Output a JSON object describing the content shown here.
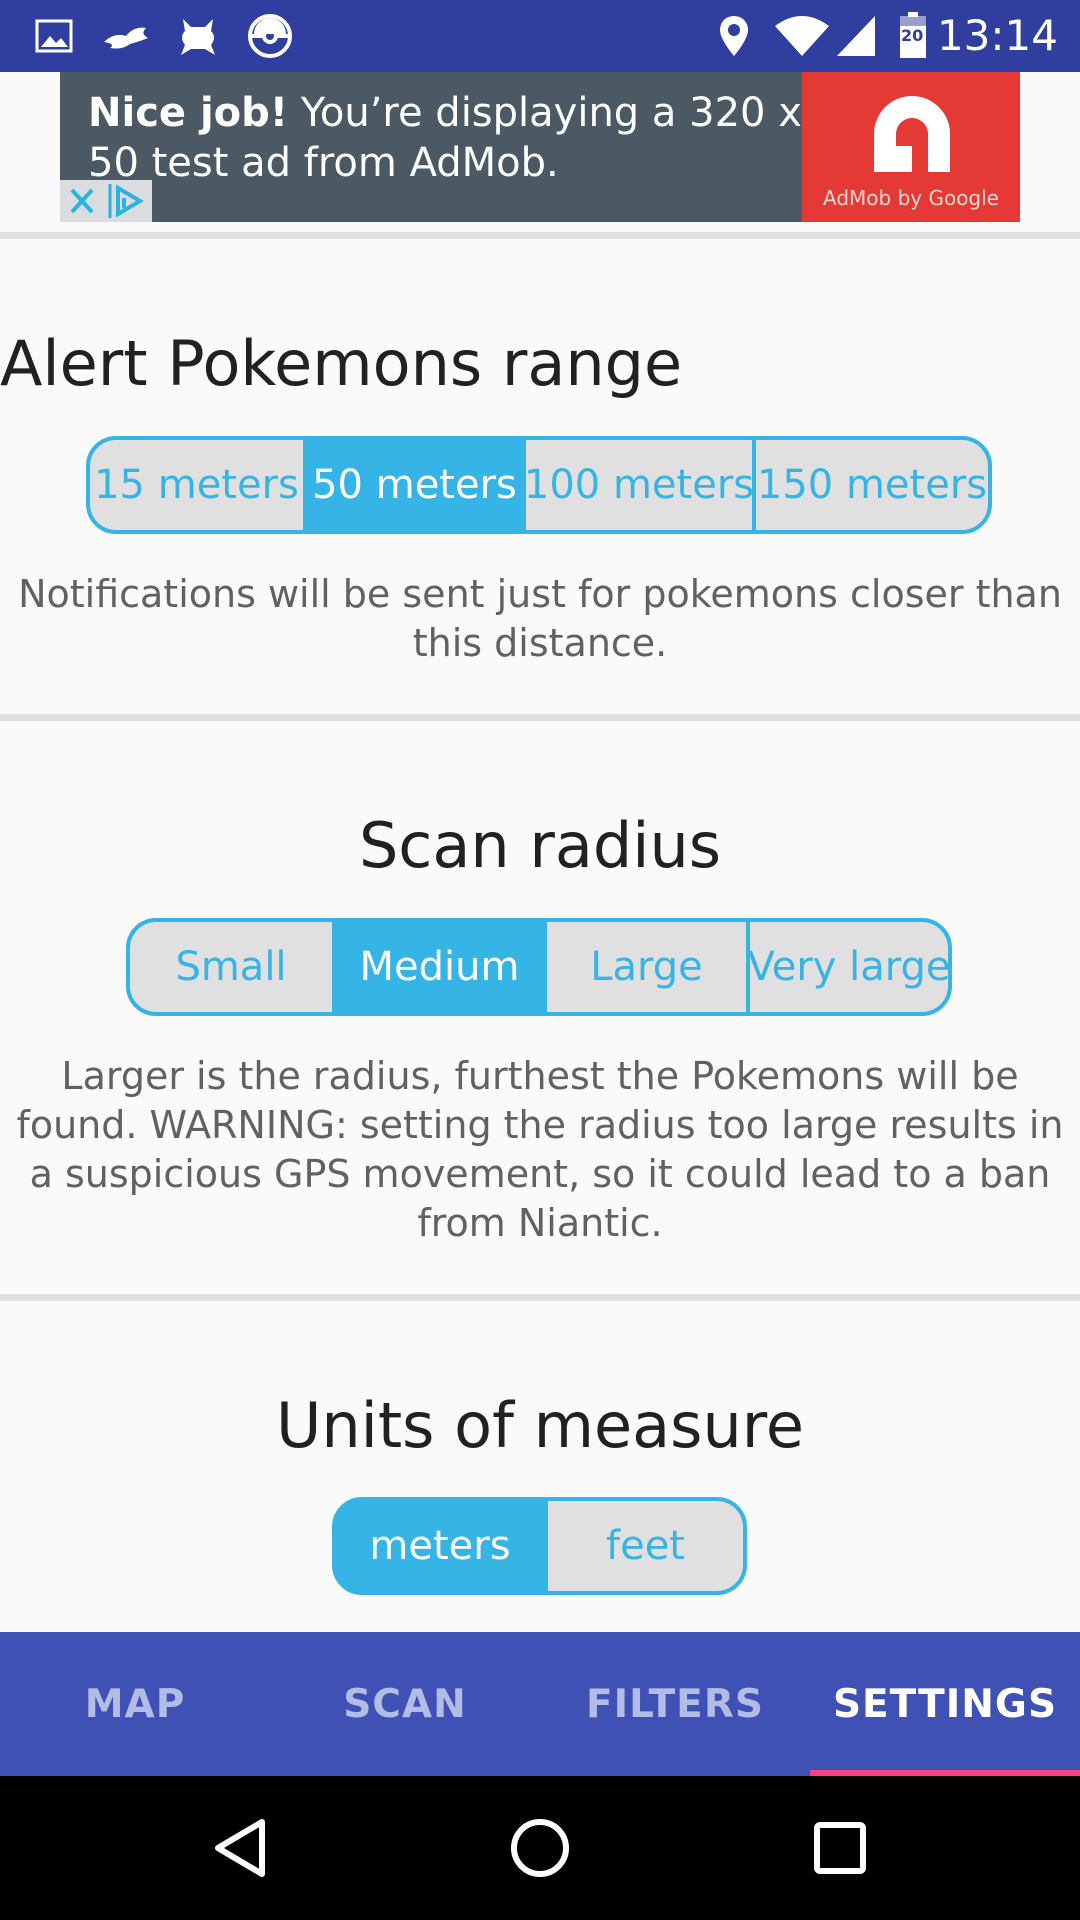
{
  "status_bar": {
    "time": "13:14",
    "battery_level": "20",
    "icons_left": [
      "image-icon",
      "pokemon-icon",
      "pokemon-icon",
      "pokeball-icon"
    ],
    "icons_right": [
      "location-icon",
      "wifi-icon",
      "signal-icon",
      "battery-icon"
    ]
  },
  "ad": {
    "headline_bold": "Nice job!",
    "headline_rest": " You’re displaying a 320 x 50 test ad from AdMob.",
    "logo_caption": "AdMob by Google"
  },
  "alert_range": {
    "title": "Alert Pokemons range",
    "options": [
      "15 meters",
      "50 meters",
      "100 meters",
      "150 meters"
    ],
    "selected": "50 meters",
    "description": "Notifications will be sent just for pokemons closer than this distance."
  },
  "scan_radius": {
    "title": "Scan radius",
    "options": [
      "Small",
      "Medium",
      "Large",
      "Very large"
    ],
    "selected": "Medium",
    "description": "Larger is the radius, furthest the Pokemons will be found. WARNING: setting the radius too large results in a suspicious GPS movement, so it could lead to a ban from Niantic."
  },
  "units": {
    "title": "Units of measure",
    "options": [
      "meters",
      "feet"
    ],
    "selected": "meters"
  },
  "tabs": [
    {
      "label": "MAP",
      "active": false
    },
    {
      "label": "SCAN",
      "active": false
    },
    {
      "label": "FILTERS",
      "active": false
    },
    {
      "label": "SETTINGS",
      "active": true
    }
  ],
  "colors": {
    "primary": "#3f51b5",
    "primary_dark": "#303f9f",
    "accent": "#35b4e5",
    "tab_indicator": "#ff4081"
  }
}
